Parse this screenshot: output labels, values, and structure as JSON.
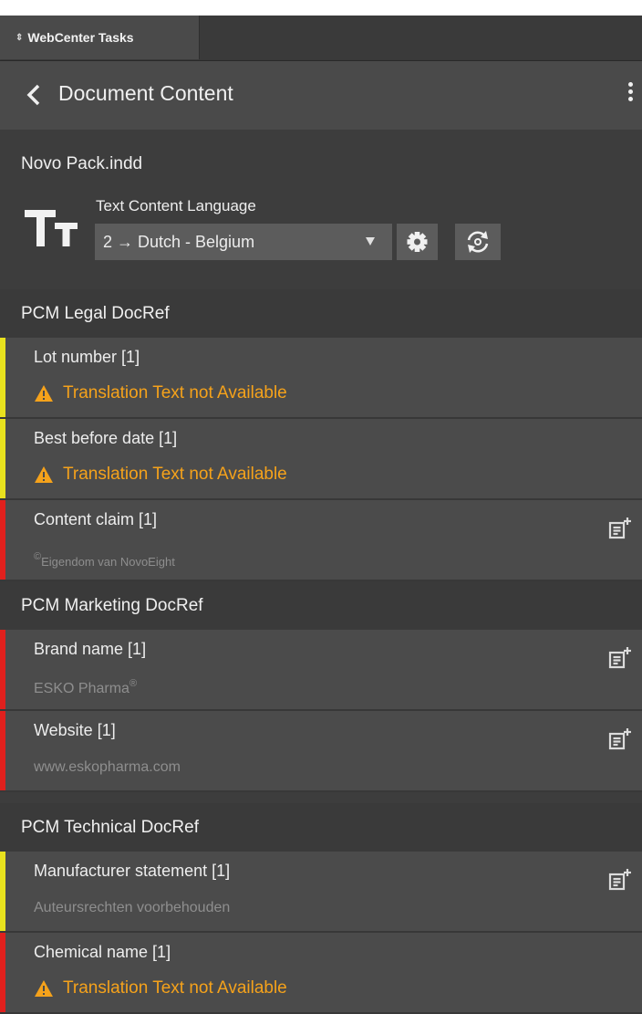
{
  "tab": {
    "updown_glyph": "⇕",
    "label": "WebCenter Tasks"
  },
  "header": {
    "title": "Document Content"
  },
  "document": {
    "name": "Novo Pack.indd",
    "language_label": "Text Content Language",
    "language_value": "2 → Dutch - Belgium"
  },
  "colors": {
    "required_bar": "#e0201d",
    "warning_bar": "#e9e21e",
    "warning_text": "#f5a21b"
  },
  "sections": [
    {
      "title": "PCM Legal DocRef"
    },
    {
      "title": "PCM Marketing DocRef"
    },
    {
      "title": "PCM Technical DocRef"
    }
  ],
  "items": [
    {
      "label": "Lot number [1]",
      "status": "warning",
      "warning_text": "Translation Text not Available"
    },
    {
      "label": "Best before date [1]",
      "status": "warning",
      "warning_text": "Translation Text not Available"
    },
    {
      "label": "Content claim [1]",
      "status": "required",
      "value_prefix": "©",
      "value": "Eigendom van NovoEight"
    },
    {
      "label": "Brand name [1]",
      "status": "required",
      "value": "ESKO Pharma",
      "value_suffix": "®"
    },
    {
      "label": "Website [1]",
      "status": "required",
      "value": "www.eskopharma.com"
    },
    {
      "label": "Manufacturer statement [1]",
      "status": "warning",
      "value": "Auteursrechten voorbehouden"
    },
    {
      "label": "Chemical name [1]",
      "status": "required",
      "warning_text": "Translation Text not Available"
    }
  ]
}
